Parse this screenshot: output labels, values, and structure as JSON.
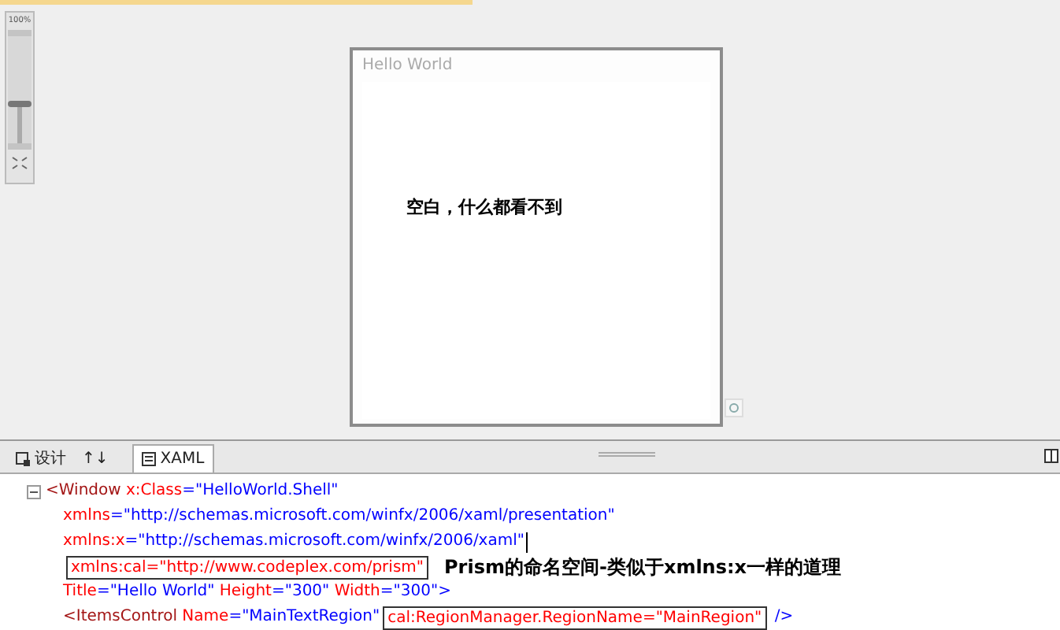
{
  "zoom": {
    "label": "100%",
    "level": 0.36
  },
  "preview": {
    "window_title": "Hello World",
    "message": "空白，什么都看不到"
  },
  "tabs": [
    {
      "label": "设计",
      "kind": "design",
      "selected": false
    },
    {
      "label": "↑↓",
      "kind": "swap",
      "selected": false
    },
    {
      "label": "XAML",
      "kind": "xaml",
      "selected": true
    }
  ],
  "code": [
    {
      "collapse": true,
      "tokens": [
        {
          "kind": "tag",
          "text": "<Window"
        },
        {
          "kind": "attr",
          "text": " x:Class"
        },
        {
          "kind": "punct",
          "text": "="
        },
        {
          "kind": "value",
          "text": "\"HelloWorld.Shell\""
        }
      ]
    },
    {
      "collapse": false,
      "tokens": [
        {
          "kind": "attr",
          "text": "xmlns"
        },
        {
          "kind": "punct",
          "text": "="
        },
        {
          "kind": "value",
          "text": "\"http://schemas.microsoft.com/winfx/2006/xaml/presentation\""
        }
      ]
    },
    {
      "collapse": false,
      "caret": true,
      "tokens": [
        {
          "kind": "attr",
          "text": "xmlns:x"
        },
        {
          "kind": "punct",
          "text": "="
        },
        {
          "kind": "value",
          "text": "\"http://schemas.microsoft.com/winfx/2006/xaml\""
        }
      ]
    },
    {
      "collapse": false,
      "tokens": [
        {
          "kind": "boxed",
          "text": "xmlns:cal=\"http://www.codeplex.com/prism\""
        },
        {
          "kind": "note",
          "text": "Prism的命名空间-类似于xmlns:x一样的道理"
        }
      ]
    },
    {
      "collapse": false,
      "tokens": [
        {
          "kind": "attr",
          "text": "Title"
        },
        {
          "kind": "punct",
          "text": "="
        },
        {
          "kind": "value",
          "text": "\"Hello World\""
        },
        {
          "kind": "attr",
          "text": " Height"
        },
        {
          "kind": "punct",
          "text": "="
        },
        {
          "kind": "value",
          "text": "\"300\""
        },
        {
          "kind": "attr",
          "text": " Width"
        },
        {
          "kind": "punct",
          "text": "="
        },
        {
          "kind": "value",
          "text": "\"300\""
        },
        {
          "kind": "punct",
          "text": ">"
        }
      ]
    },
    {
      "collapse": false,
      "tokens": [
        {
          "kind": "tag",
          "text": "<ItemsControl"
        },
        {
          "kind": "attr",
          "text": " Name"
        },
        {
          "kind": "punct",
          "text": "="
        },
        {
          "kind": "value",
          "text": "\"MainTextRegion\""
        },
        {
          "kind": "boxed",
          "text": "cal:RegionManager.RegionName=\"MainRegion\""
        },
        {
          "kind": "punct",
          "text": " />"
        }
      ]
    }
  ]
}
